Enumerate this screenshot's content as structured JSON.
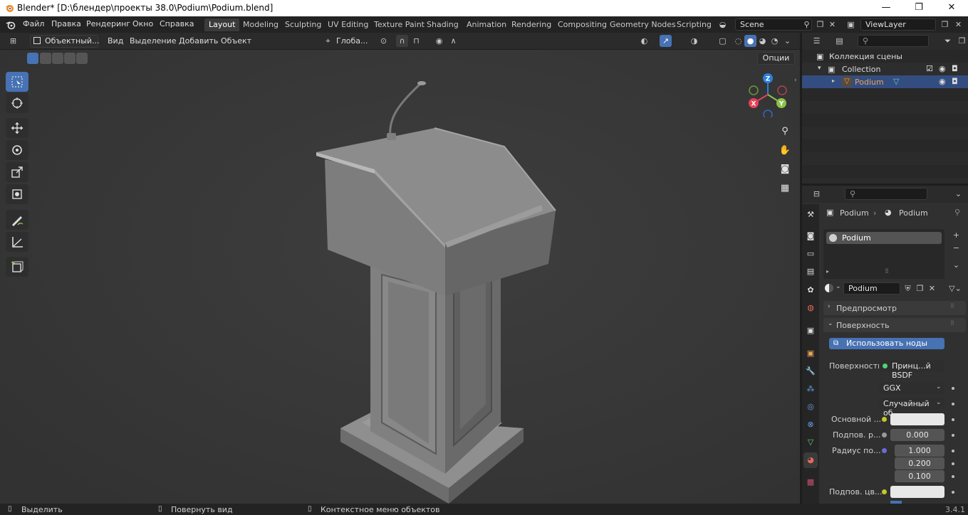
{
  "window": {
    "title": "Blender* [D:\\блендер\\проекты 38.0\\Podium\\Podium.blend]",
    "minimize": "—",
    "maximize": "❐",
    "close": "✕"
  },
  "menus": [
    "Файл",
    "Правка",
    "Рендеринг",
    "Окно",
    "Справка"
  ],
  "workspaces": [
    {
      "label": "Layout",
      "active": true
    },
    {
      "label": "Modeling"
    },
    {
      "label": "Sculpting"
    },
    {
      "label": "UV Editing"
    },
    {
      "label": "Texture Paint"
    },
    {
      "label": "Shading"
    },
    {
      "label": "Animation"
    },
    {
      "label": "Rendering"
    },
    {
      "label": "Compositing"
    },
    {
      "label": "Geometry Nodes"
    },
    {
      "label": "Scripting"
    }
  ],
  "scene": {
    "name": "Scene",
    "view_layer": "ViewLayer"
  },
  "viewport": {
    "mode": "Объектный...",
    "menus": [
      "Вид",
      "Выделение",
      "Добавить",
      "Объект"
    ],
    "transform_orientation": "Глоба...",
    "options_label": "Опции",
    "gizmo_axes": {
      "z": "Z",
      "y": "Y",
      "x": "X"
    }
  },
  "outliner": {
    "scene_collection": "Коллекция сцены",
    "collection": "Collection",
    "object": "Podium"
  },
  "properties": {
    "breadcrumb_object": "Podium",
    "breadcrumb_material": "Podium",
    "material_slot": "Podium",
    "material_name": "Podium",
    "panels": {
      "preview": "Предпросмотр",
      "surface": "Поверхность"
    },
    "use_nodes": "Использовать ноды",
    "surface_label": "Поверхность",
    "surface_value": "Принц...й BSDF",
    "distribution": "GGX",
    "subsurface_method": "Случайный об...",
    "base_color_label": "Основной ...",
    "subsurface_label": "Подпов. р...",
    "subsurface_value": "0.000",
    "subsurface_radius_label": "Радиус по...",
    "radius_values": [
      "1.000",
      "0.200",
      "0.100"
    ],
    "subsurface_color_label": "Подпов. цв..."
  },
  "statusbar": {
    "select": "Выделить",
    "rotate_view": "Повернуть вид",
    "context_menu": "Контекстное меню объектов",
    "version": "3.4.1"
  },
  "colors": {
    "accent": "#4772b3",
    "selected_row": "#334d80",
    "object_orange": "#e8a45a",
    "x_axis": "#e64058",
    "y_axis": "#8bc34a",
    "z_axis": "#2d7fe0"
  }
}
